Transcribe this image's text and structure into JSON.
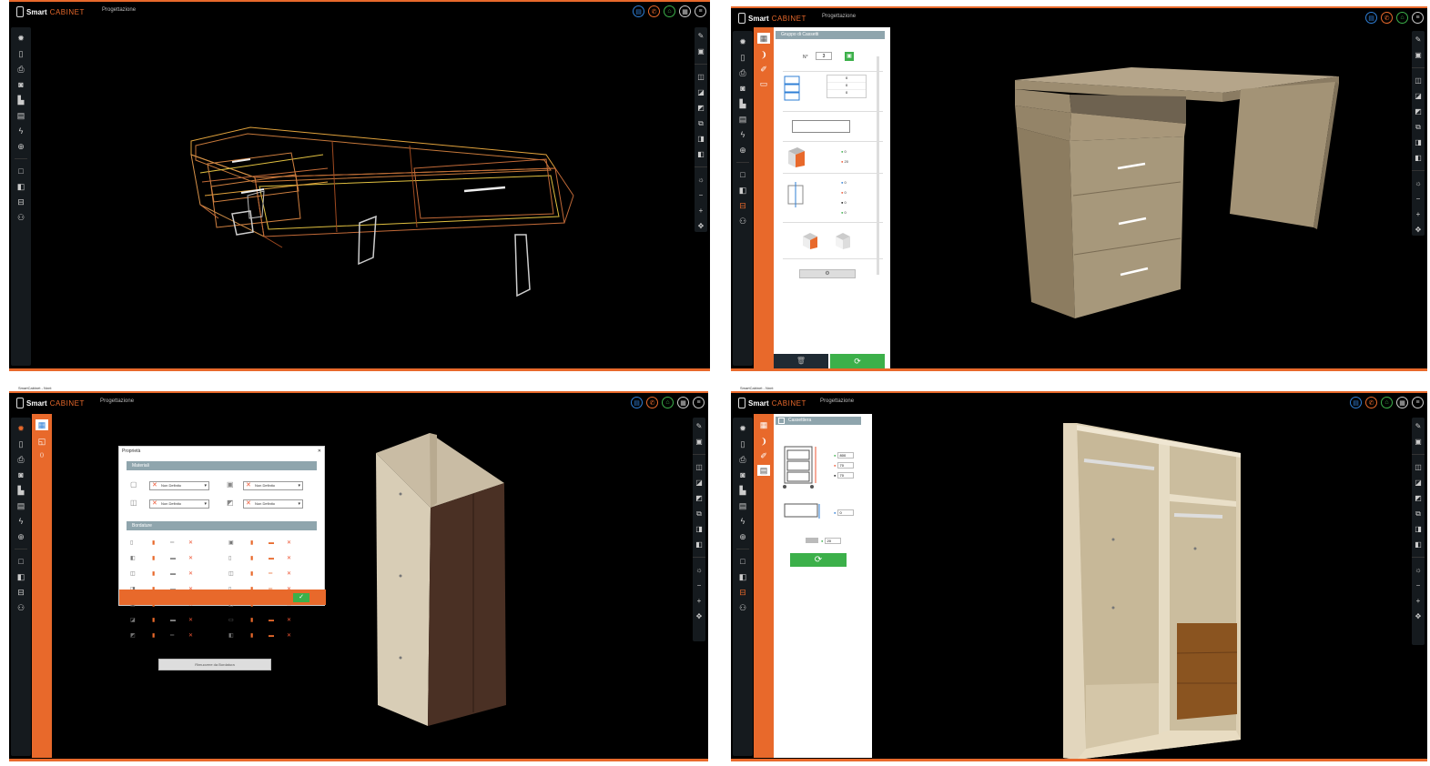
{
  "app": {
    "brand_bold": "Smart",
    "brand_light": "CABINET",
    "menu_label": "Progettazione",
    "window_title_q3": "SmartCabinet - Nnnt",
    "window_title_q4": "SmartCabinet - Nnnt"
  },
  "colors": {
    "accent": "#e8692b",
    "panel_header": "#8fa5ad",
    "green": "#3cb04a",
    "blue": "#2f7fd6"
  },
  "top_icons": [
    "document-icon",
    "phone-icon",
    "home-icon",
    "building-icon",
    "menu-icon"
  ],
  "q2": {
    "panel_title": "Gruppo di Cassetti",
    "count_label": "N°",
    "count_value": "3",
    "grid_values": [
      "0",
      "0",
      "0"
    ],
    "dim_values_a": [
      "0",
      "20"
    ],
    "dim_values_b": [
      "0",
      "0",
      "0",
      "0"
    ]
  },
  "q3": {
    "dialog_title": "Proprietà",
    "section_materials": "Materiali",
    "section_edges": "Bordature",
    "material_options": [
      "Non Definito",
      "Non Definito",
      "Non Definito",
      "Non Definito"
    ],
    "apply_button": "Rimuovere da Bordatura",
    "ok_icon": "check-icon"
  },
  "q4": {
    "panel_title": "Cassettiera",
    "dims": [
      "800",
      "70",
      "70"
    ],
    "offset_value": "0",
    "spacing_value": "20"
  }
}
